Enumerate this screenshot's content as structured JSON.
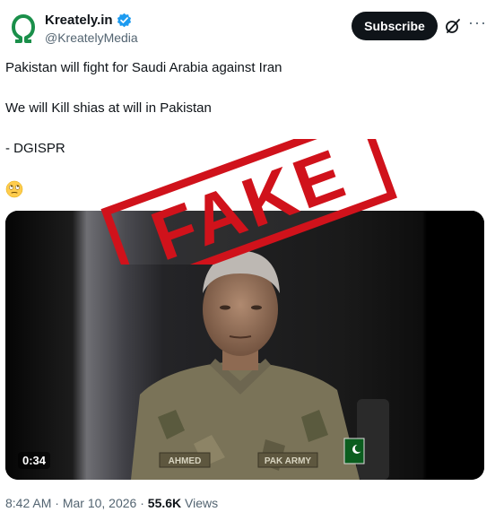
{
  "account": {
    "display_name": "Kreately.in",
    "handle": "@KreatelyMedia"
  },
  "actions": {
    "subscribe_label": "Subscribe"
  },
  "post": {
    "lines": [
      "Pakistan will fight for Saudi Arabia against Iran",
      "We will Kill shias at will in Pakistan",
      "- DGISPR"
    ],
    "emoji": "face-with-rolling-eyes-icon"
  },
  "media": {
    "duration": "0:34",
    "overlay_stamp": "FAKE",
    "badge_left": "AHMED",
    "badge_right": "PAK ARMY"
  },
  "meta": {
    "time": "8:42 AM",
    "separator": " · ",
    "date": "Mar 10, 2026",
    "views_count": "55.6K",
    "views_label": "Views"
  },
  "colors": {
    "brand_green": "#1a8f4a",
    "verified_blue": "#1d9bf0",
    "stamp_red": "#d0121b",
    "muted_text": "#536471"
  }
}
